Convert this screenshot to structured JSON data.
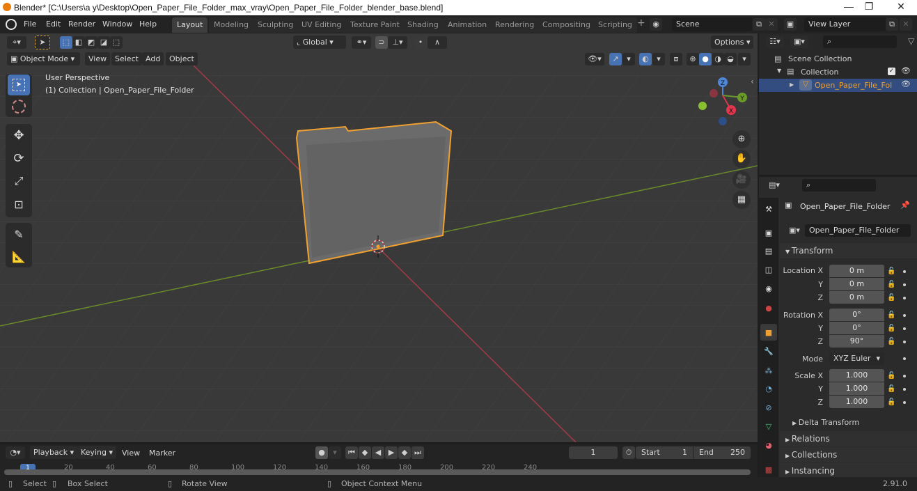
{
  "window": {
    "title": "Blender* [C:\\Users\\a y\\Desktop\\Open_Paper_File_Folder_max_vray\\Open_Paper_File_Folder_blender_base.blend]",
    "controls": {
      "minimize": "—",
      "maximize": "❐",
      "close": "✕"
    }
  },
  "menubar": {
    "items": [
      "File",
      "Edit",
      "Render",
      "Window",
      "Help"
    ],
    "workspaces": [
      "Layout",
      "Modeling",
      "Sculpting",
      "UV Editing",
      "Texture Paint",
      "Shading",
      "Animation",
      "Rendering",
      "Compositing",
      "Scripting"
    ],
    "active_workspace": "Layout",
    "add_workspace": "+",
    "scene": "Scene",
    "view_layer": "View Layer"
  },
  "viewport": {
    "header": {
      "transform_orientation": "Global",
      "options": "Options",
      "mode": "Object Mode",
      "menus": [
        "View",
        "Select",
        "Add",
        "Object"
      ]
    },
    "overlay_text": {
      "perspective": "User Perspective",
      "collection": "(1) Collection | Open_Paper_File_Folder"
    },
    "tools": [
      "select-box",
      "cursor",
      "move",
      "rotate",
      "scale",
      "transform",
      "annotate",
      "measure"
    ],
    "gizmo": {
      "x": "X",
      "y": "Y",
      "z": "Z"
    },
    "colors": {
      "x_axis": "#a33b47",
      "y_axis": "#6a8a2a",
      "selection": "#f0a030",
      "active_blue": "#4772b3"
    }
  },
  "outliner": {
    "search_placeholder": "",
    "items": [
      {
        "label": "Scene Collection",
        "level": 0
      },
      {
        "label": "Collection",
        "level": 1,
        "checked": true
      },
      {
        "label": "Open_Paper_File_Fol",
        "level": 2,
        "selected": true
      }
    ]
  },
  "properties": {
    "search_placeholder": "",
    "object_name": "Open_Paper_File_Folder",
    "datablock_name": "Open_Paper_File_Folder",
    "transform": {
      "title": "Transform",
      "location_label": "Location X",
      "location": [
        "0 m",
        "0 m",
        "0 m"
      ],
      "rotation_label": "Rotation X",
      "rotation": [
        "0°",
        "0°",
        "90°"
      ],
      "mode_label": "Mode",
      "mode": "XYZ Euler",
      "scale_label": "Scale X",
      "scale": [
        "1.000",
        "1.000",
        "1.000"
      ],
      "axis_y": "Y",
      "axis_z": "Z"
    },
    "subpanels": [
      "Delta Transform"
    ],
    "panels": [
      "Relations",
      "Collections",
      "Instancing"
    ]
  },
  "timeline": {
    "menus": [
      "Playback",
      "Keying",
      "View",
      "Marker"
    ],
    "current_frame": "1",
    "start_label": "Start",
    "start": "1",
    "end_label": "End",
    "end": "250",
    "ruler": [
      "1",
      "20",
      "40",
      "60",
      "80",
      "100",
      "120",
      "140",
      "160",
      "180",
      "200",
      "220",
      "240"
    ]
  },
  "statusbar": {
    "select": "Select",
    "box_select": "Box Select",
    "rotate_view": "Rotate View",
    "context_menu": "Object Context Menu",
    "version": "2.91.0"
  }
}
